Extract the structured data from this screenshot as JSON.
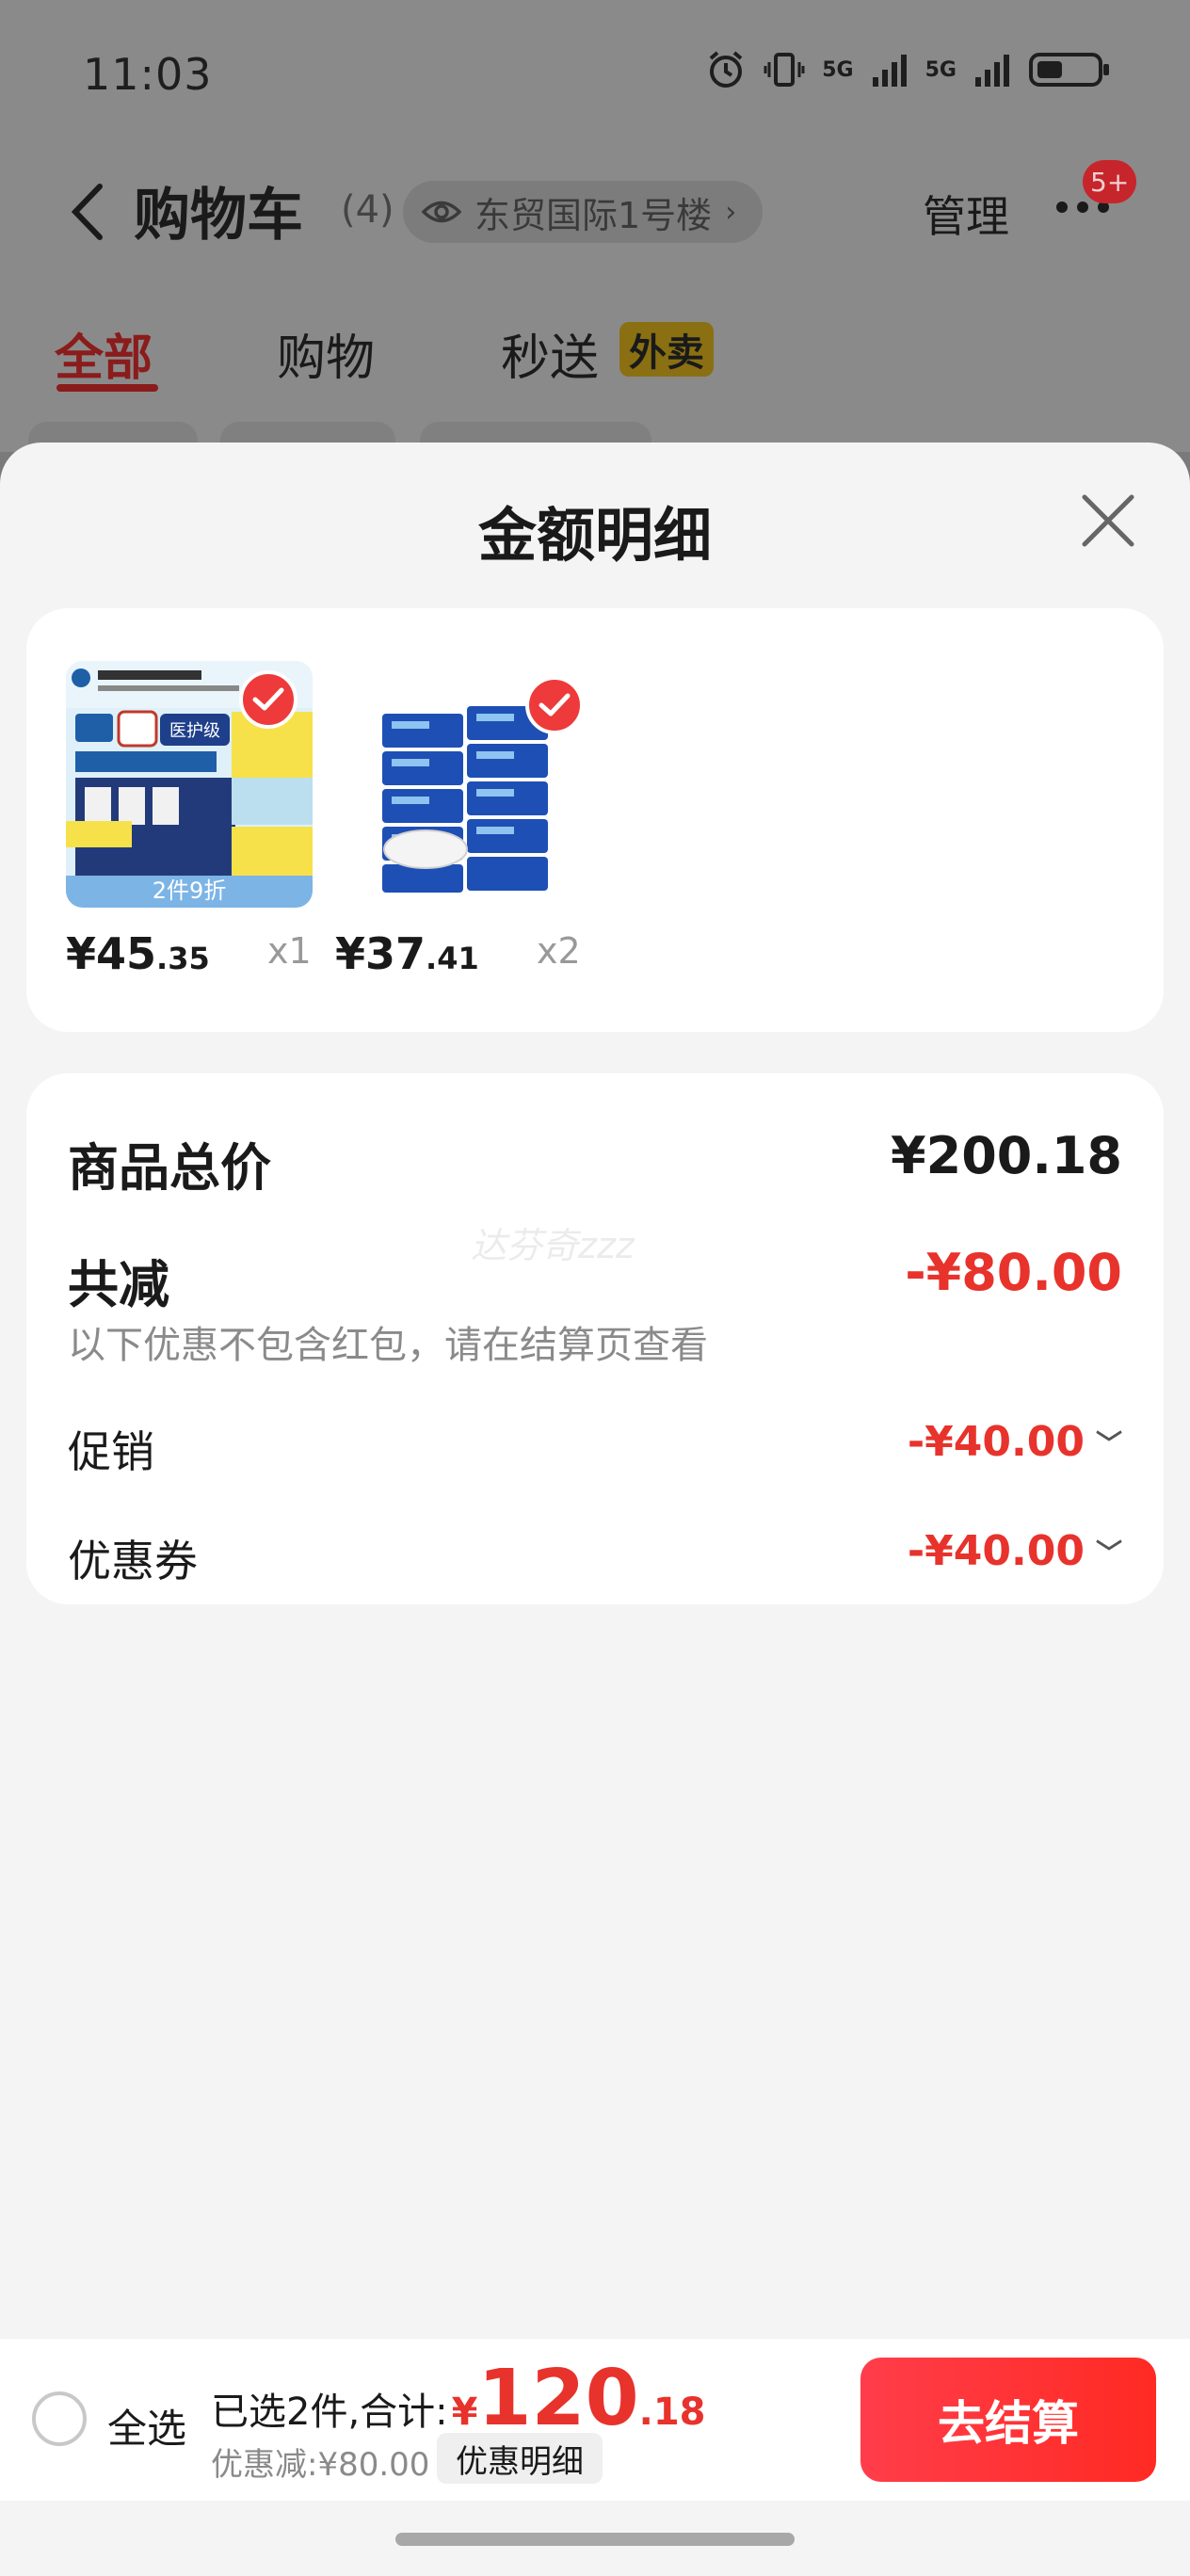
{
  "status_bar": {
    "time": "11:03",
    "network_1": "5G",
    "network_2": "5G"
  },
  "header": {
    "title": "购物车",
    "count": "(4)",
    "address": "东贸国际1号楼",
    "manage": "管理",
    "badge": "5+"
  },
  "tabs": [
    {
      "label": "全部",
      "active": true
    },
    {
      "label": "购物",
      "active": false
    },
    {
      "label": "秒送",
      "active": false
    }
  ],
  "tab_tag": "外卖",
  "sheet": {
    "title": "金额明细",
    "items": [
      {
        "price_int": "¥45",
        "price_dec": ".35",
        "qty": "x1",
        "promo_tag": "2件9折",
        "img_label": "医护级",
        "selected": true
      },
      {
        "price_int": "¥37",
        "price_dec": ".41",
        "qty": "x2",
        "selected": true
      }
    ],
    "summary": {
      "total_label": "商品总价",
      "total_value": "¥200.18",
      "reduce_label": "共减",
      "reduce_value": "-¥80.00",
      "note": "以下优惠不包含红包，请在结算页查看",
      "promo_label": "促销",
      "promo_value": "-¥40.00",
      "coupon_label": "优惠券",
      "coupon_value": "-¥40.00",
      "watermark": "达芬奇zzz"
    }
  },
  "bottom": {
    "select_all": "全选",
    "total_prefix": "已选2件,合计:",
    "total_yen": "¥",
    "total_int": "120",
    "total_dec": ".18",
    "discount": "优惠减:¥80.00",
    "detail_button": "优惠明细",
    "checkout": "去结算"
  },
  "colors": {
    "accent_red": "#e8322c",
    "checkout_red": "#ff3d4a"
  }
}
